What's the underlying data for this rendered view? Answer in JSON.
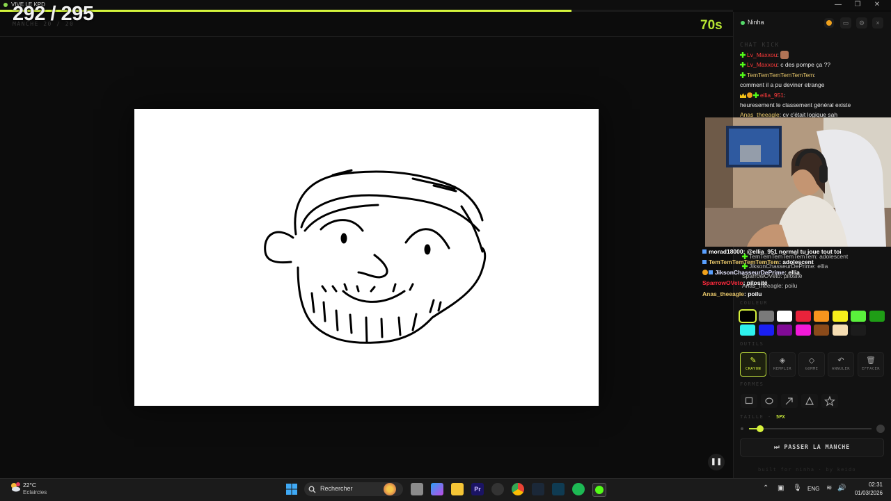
{
  "window": {
    "title": "VIVE LE KPD",
    "minimize": "—",
    "restore": "❐",
    "close": "✕"
  },
  "game": {
    "score": "292 / 295",
    "round_label": "MANCHE 20 / 20",
    "timer": "70s",
    "progress": 0.78
  },
  "panel": {
    "username": "Ninha",
    "chat_title": "CHAT KICK",
    "chat": [
      {
        "name": "Lv_Maxxou",
        "sep": ":",
        "text": ""
      },
      {
        "name": "Lv_Maxxou",
        "sep": ":",
        "text": " c des pompe ça ??"
      },
      {
        "name": "TemTemTemTemTemTem",
        "sep": ":",
        "text": ""
      },
      {
        "name": "",
        "sep": "",
        "text": "comment il a pu deviner etrange"
      },
      {
        "name": "ellia_951",
        "sep": ":",
        "text": ""
      },
      {
        "name": "",
        "sep": "",
        "text": "heuresement le classement général existe"
      },
      {
        "name": "Anas_theeagle",
        "sep": ":",
        "text": " cv c'était logique sah"
      }
    ],
    "overlay_chat": [
      {
        "name": "morad18000",
        "text": ": @ellia_951 normal tu joue tout toi"
      },
      {
        "name": "TemTemTemTemTemTem",
        "text": ": adolescent"
      },
      {
        "name": "JiksonChasseurDePrime",
        "text": ": ellia"
      },
      {
        "name": "SparrowOVeto",
        "text": ": pilosité"
      },
      {
        "name": "Anas_theeagle",
        "text": ": poilu"
      }
    ],
    "overlay_ghost": [
      {
        "name": "TemTemTemTemTemTem",
        "text": ": adolescent"
      },
      {
        "name": "JiksonChasseurDePrime",
        "text": ": ellia"
      },
      {
        "name": "SparrowOVeto",
        "text": ": pilosité"
      },
      {
        "name": "Anas_theeagle",
        "text": ": poilu"
      }
    ],
    "color_label": "COULEUR",
    "colors": [
      "#000000",
      "#7a7a7a",
      "#ffffff",
      "#e8233b",
      "#f7941d",
      "#f7ef1b",
      "#5af03c",
      "#1f9d16",
      "#2ef2ee",
      "#1a1ff2",
      "#800a96",
      "#f219d8",
      "#8a4a1a",
      "#f5ddb2"
    ],
    "tools_label": "OUTILS",
    "tools": [
      {
        "label": "CRAYON",
        "icon": "✎",
        "icon_name": "pencil-icon"
      },
      {
        "label": "REMPLIR",
        "icon": "◈",
        "icon_name": "fill-icon"
      },
      {
        "label": "GOMME",
        "icon": "◇",
        "icon_name": "eraser-icon"
      },
      {
        "label": "ANNULER",
        "icon": "↶",
        "icon_name": "undo-icon"
      },
      {
        "label": "EFFACER",
        "icon": "🗑",
        "icon_name": "trash-icon"
      }
    ],
    "shape_label": "FORMES",
    "size_label": "TAILLE -",
    "size_value": "5PX",
    "size_fraction": 0.09,
    "skip_label": "⏭ PASSER LA MANCHE",
    "footer": "built for ninha · by keido"
  },
  "taskbar": {
    "temperature": "22°C",
    "weather": "Eclaircies",
    "search_placeholder": "Rechercher",
    "language": "ENG",
    "time": "02:31",
    "date": "01/03/2026"
  }
}
